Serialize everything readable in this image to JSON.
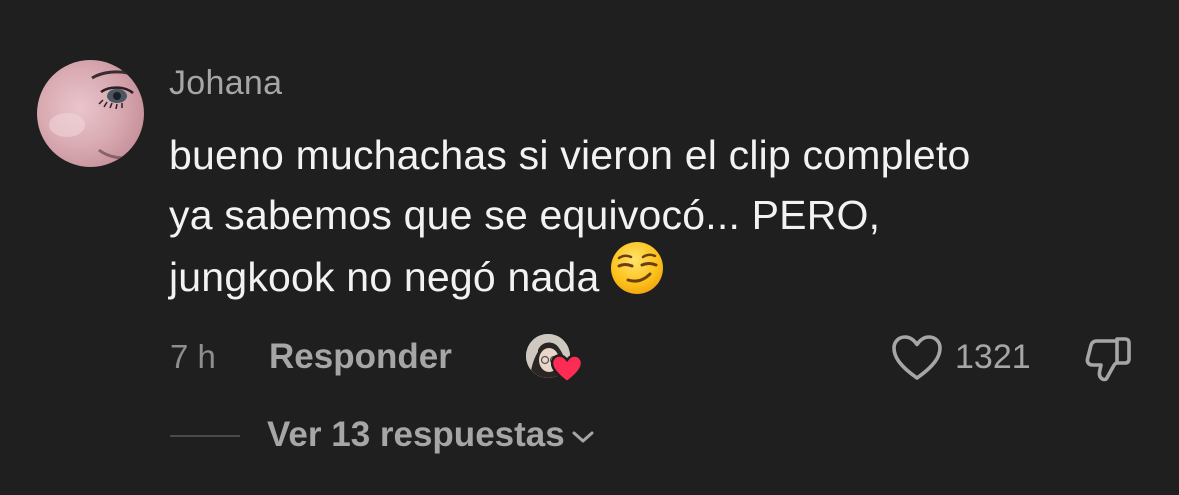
{
  "comment": {
    "username": "Johana",
    "text_lines": [
      "bueno muchachas si vieron el clip completo",
      "ya sabemos que se equivocó... PERO,",
      "jungkook no negó nada"
    ],
    "emoji": "smirking-face"
  },
  "actions": {
    "timestamp": "7 h",
    "reply_label": "Responder",
    "like_count": "1321"
  },
  "replies": {
    "label": "Ver 13 respuestas"
  },
  "colors": {
    "background": "#1f1f1f",
    "primary_text": "#f2f2f2",
    "secondary_text": "#a6a6a6",
    "heart_badge": "#fe2c55"
  }
}
